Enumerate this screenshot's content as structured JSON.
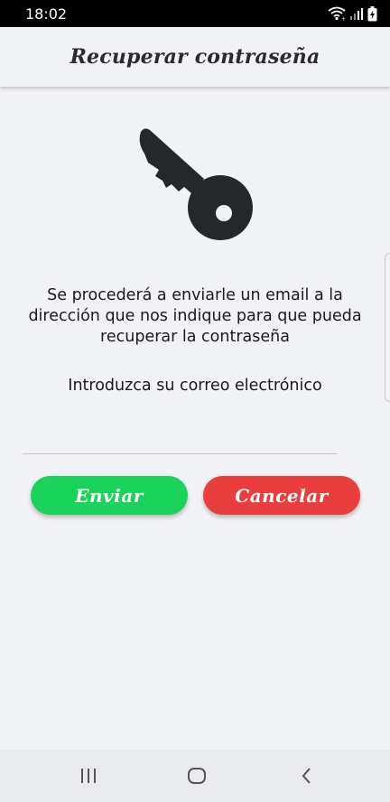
{
  "status_bar": {
    "time": "18:02"
  },
  "header": {
    "title": "Recuperar contraseña"
  },
  "content": {
    "intro_text": "Se procederá a enviarle un email a la dirección que nos indique para que pueda recuperar la contraseña",
    "prompt_text": "Introduzca su correo electrónico"
  },
  "form": {
    "email_value": "",
    "email_placeholder": ""
  },
  "buttons": {
    "send_label": "Enviar",
    "cancel_label": "Cancelar"
  },
  "colors": {
    "send": "#1ad35a",
    "cancel": "#ea3e3e",
    "background": "#f2f3f7",
    "icon": "#25272b"
  },
  "icons": {
    "hero": "key-icon",
    "status": [
      "wifi-icon",
      "signal-icon",
      "battery-charging-icon"
    ],
    "nav": [
      "recents-icon",
      "home-icon",
      "back-icon"
    ]
  }
}
